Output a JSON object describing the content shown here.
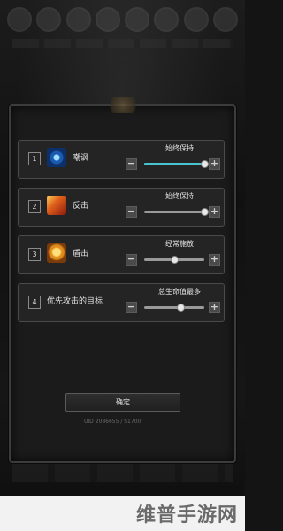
{
  "skills": [
    {
      "num": "1",
      "label": "嘲讽",
      "setting": "始终保持",
      "level": 1.0,
      "icon": "taunt-eye-icon",
      "icon_color": "#2a7ad0"
    },
    {
      "num": "2",
      "label": "反击",
      "setting": "始终保持",
      "level": 1.0,
      "icon": "counter-strike-icon",
      "icon_color": "#d04a1a"
    },
    {
      "num": "3",
      "label": "盾击",
      "setting": "经常施放",
      "level": 0.5,
      "icon": "shield-bash-icon",
      "icon_color": "#e0901a"
    },
    {
      "num": "4",
      "label": "优先攻击的目标",
      "setting": "总生命值最多",
      "level": 0.6
    }
  ],
  "minus_symbol": "−",
  "plus_symbol": "+",
  "confirm_label": "确定",
  "footer_id": "UID 2086655 / S1700",
  "watermark": "维普手游网",
  "accent_color": "#48c4d0"
}
